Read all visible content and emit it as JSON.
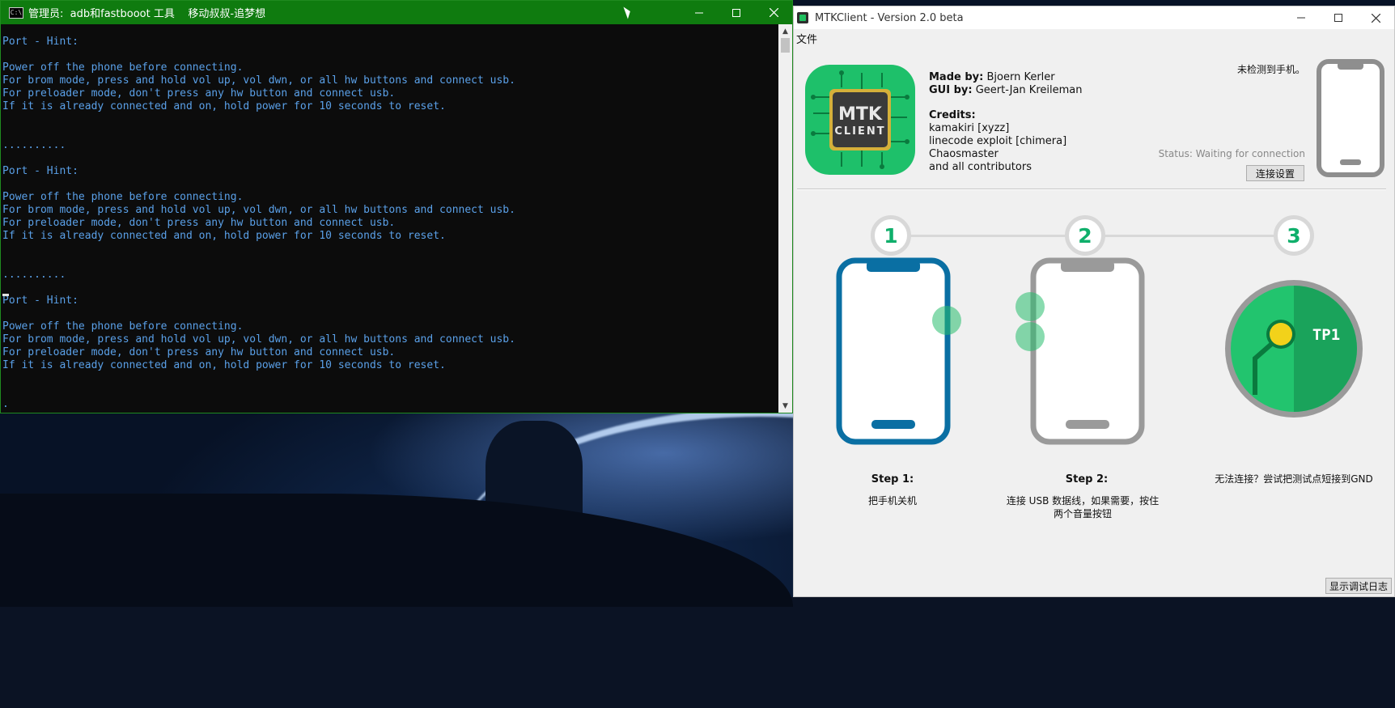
{
  "console": {
    "title": "管理员:  adb和fastbooot 工具    移动叔叔-追梦想",
    "lines": [
      "Port - Hint:",
      "",
      "Power off the phone before connecting.",
      "For brom mode, press and hold vol up, vol dwn, or all hw buttons and connect usb.",
      "For preloader mode, don't press any hw button and connect usb.",
      "If it is already connected and on, hold power for 10 seconds to reset.",
      "",
      "",
      "..........",
      "",
      "Port - Hint:",
      "",
      "Power off the phone before connecting.",
      "For brom mode, press and hold vol up, vol dwn, or all hw buttons and connect usb.",
      "For preloader mode, don't press any hw button and connect usb.",
      "If it is already connected and on, hold power for 10 seconds to reset.",
      "",
      "",
      "..........",
      "",
      "Port - Hint:",
      "",
      "Power off the phone before connecting.",
      "For brom mode, press and hold vol up, vol dwn, or all hw buttons and connect usb.",
      "For preloader mode, don't press any hw button and connect usb.",
      "If it is already connected and on, hold power for 10 seconds to reset.",
      "",
      "",
      "."
    ],
    "text_color": "#5aa0e8",
    "title_bar_color": "#0f7b0f"
  },
  "mtk": {
    "title": "MTKClient - Version 2.0 beta",
    "menu": [
      "文件"
    ],
    "logo": {
      "line1": "MTK",
      "line2": "CLIENT"
    },
    "made_by_label": "Made by:",
    "made_by_value": " Bjoern Kerler",
    "gui_by_label": "GUI by:",
    "gui_by_value": " Geert-Jan Kreileman",
    "credits_label": "Credits:",
    "credits": [
      "kamakiri [xyzz]",
      "linecode exploit [chimera]",
      "Chaosmaster",
      "and all contributors"
    ],
    "phone_status": "未检测到手机。",
    "status_text": "Status: Waiting for connection",
    "connect_settings_button": "连接设置",
    "steps": [
      {
        "number": "1",
        "title": "Step 1:",
        "desc": "把手机关机"
      },
      {
        "number": "2",
        "title": "Step 2:",
        "desc": "连接 USB 数据线，如果需要，按住两个音量按钮"
      },
      {
        "number": "3",
        "title": "",
        "desc": "无法连接？尝试把测试点短接到GND"
      }
    ],
    "tp_label": "TP1",
    "debug_log_button": "显示调试日志",
    "accent_green": "#0faf6b",
    "phone_blue": "#0a6fa3"
  }
}
